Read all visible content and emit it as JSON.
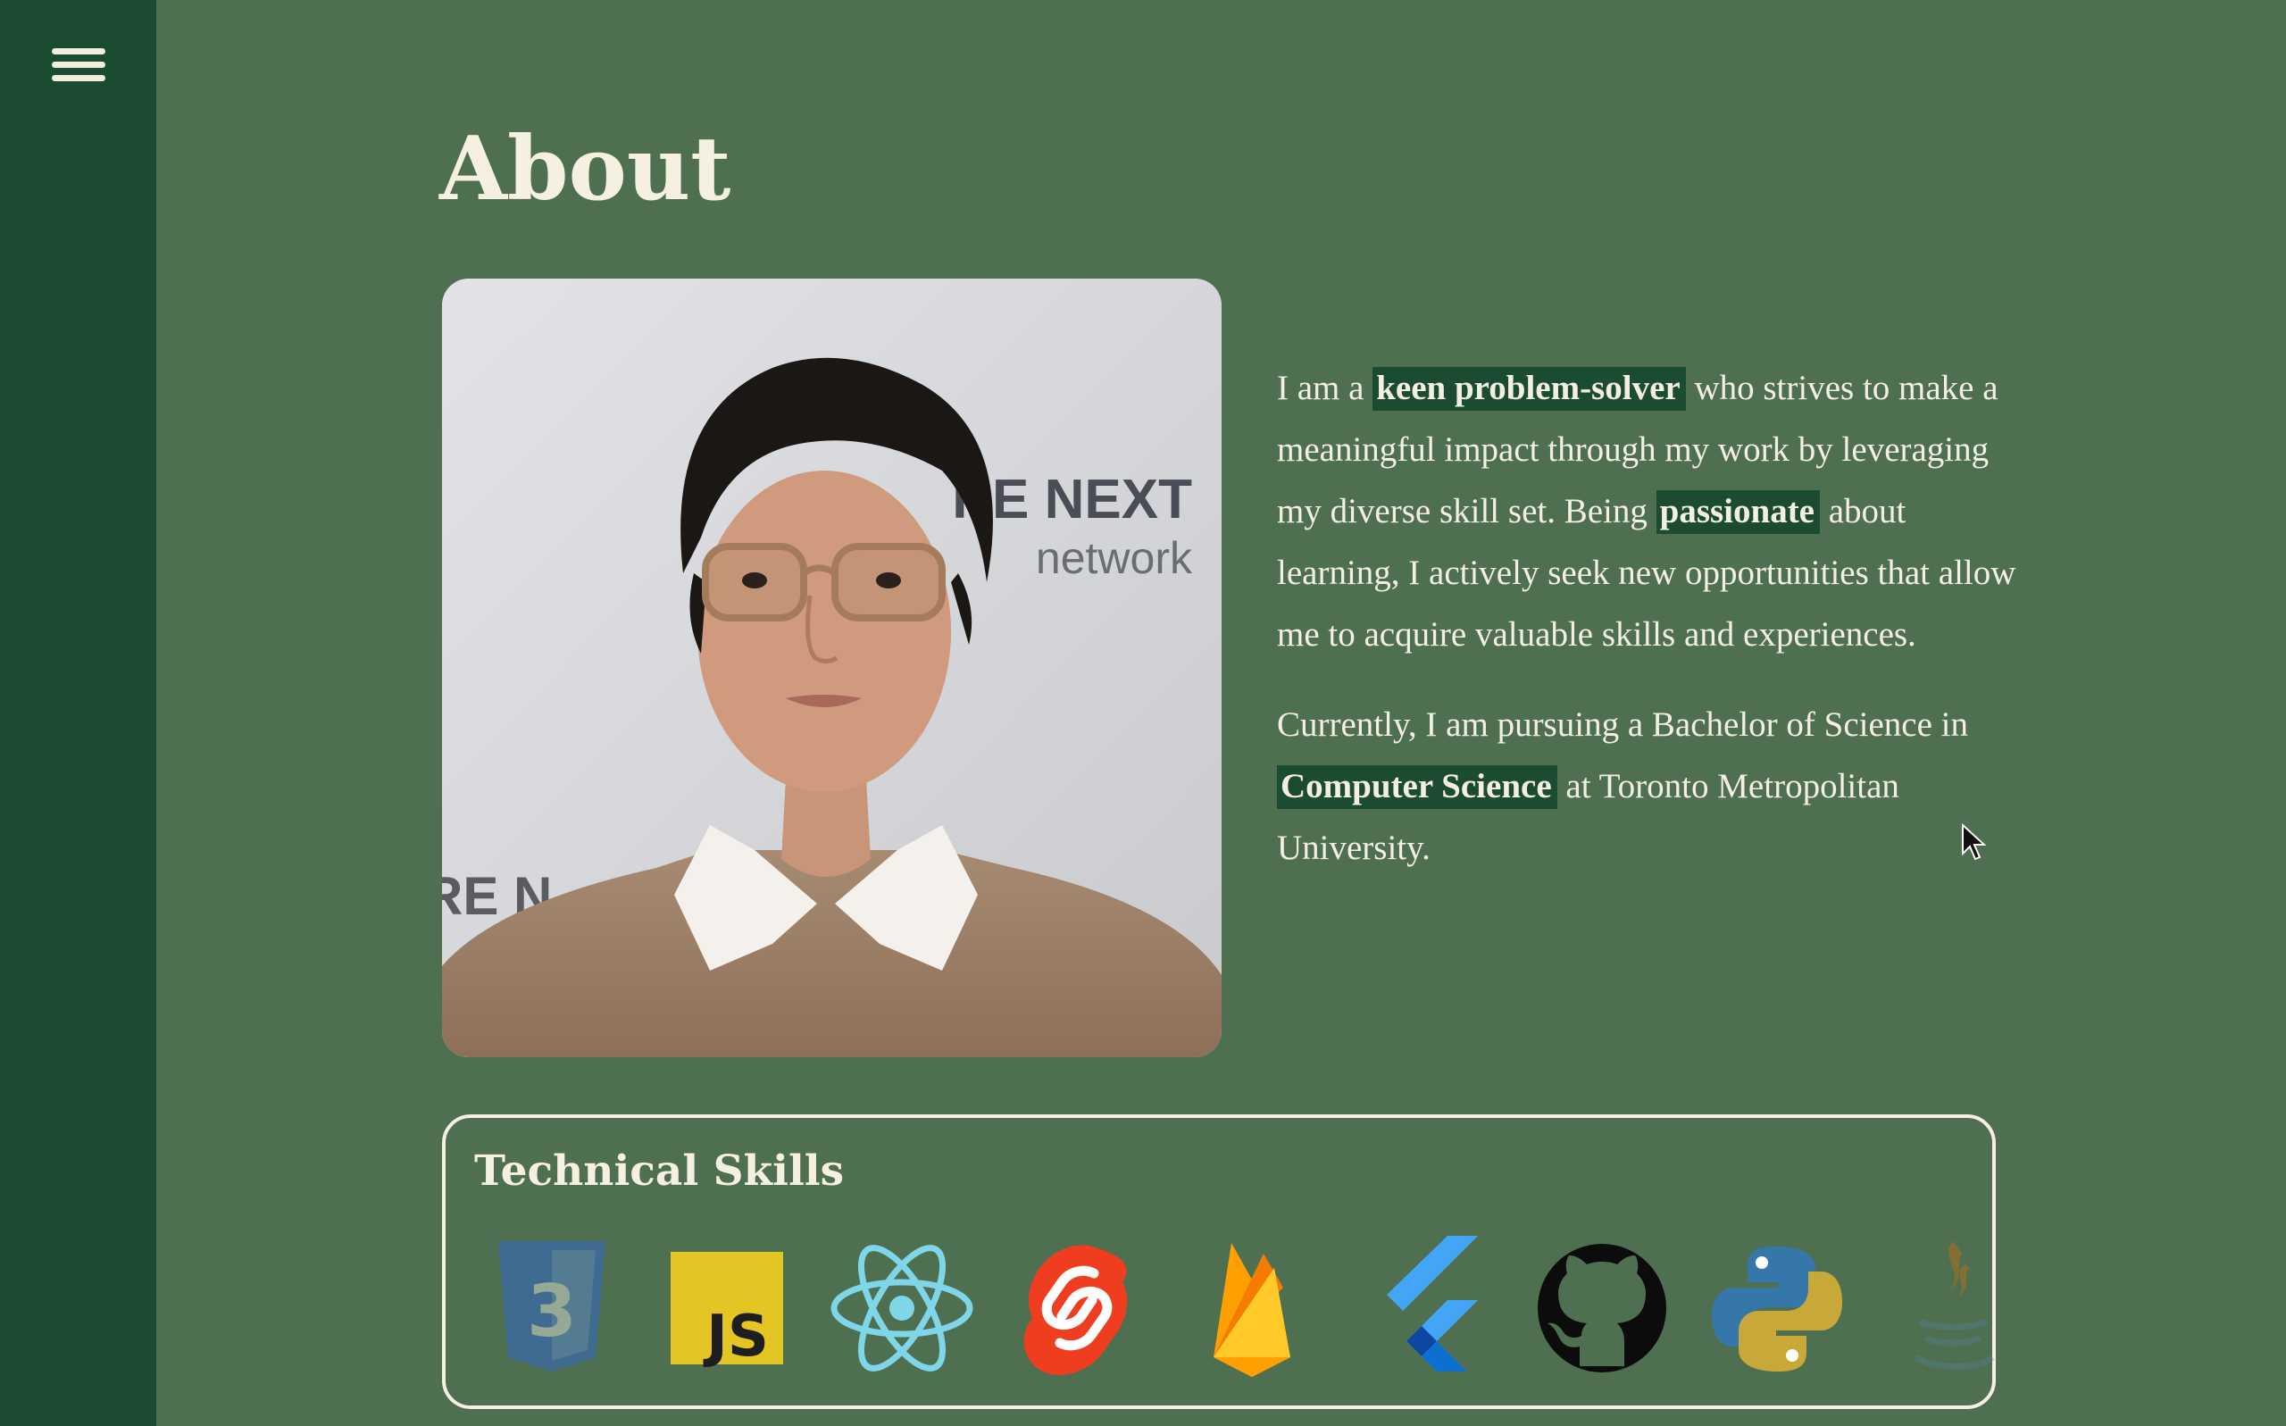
{
  "sidebar": {
    "menu_icon": "hamburger-menu-icon"
  },
  "about": {
    "title": "About",
    "photo_backdrop": {
      "line1": "RE NEXT",
      "line2": "network",
      "corner": "RE N"
    },
    "bio": {
      "p1_before": "I am a ",
      "p1_highlight1": "keen problem-solver",
      "p1_middle": " who strives to make a meaningful impact through my work by leveraging my diverse skill set. Being ",
      "p1_highlight2": "passionate",
      "p1_after": " about learning, I actively seek new opportunities that allow me to acquire valuable skills and experiences.",
      "p2_before": "Currently, I am pursuing a Bachelor of Science in ",
      "p2_highlight": "Computer Science",
      "p2_after": " at Toronto Metropolitan University."
    }
  },
  "skills": {
    "title": "Technical Skills",
    "icons": [
      {
        "name": "css3-icon",
        "label": "3"
      },
      {
        "name": "javascript-icon",
        "label": "JS"
      },
      {
        "name": "react-icon"
      },
      {
        "name": "svelte-icon"
      },
      {
        "name": "firebase-icon"
      },
      {
        "name": "flutter-icon"
      },
      {
        "name": "github-icon"
      },
      {
        "name": "python-icon"
      },
      {
        "name": "java-icon"
      }
    ]
  },
  "colors": {
    "page_background": "#4f7050",
    "sidebar": "#1b4b30",
    "highlight": "#1b4b30",
    "text": "#f3efe2"
  }
}
